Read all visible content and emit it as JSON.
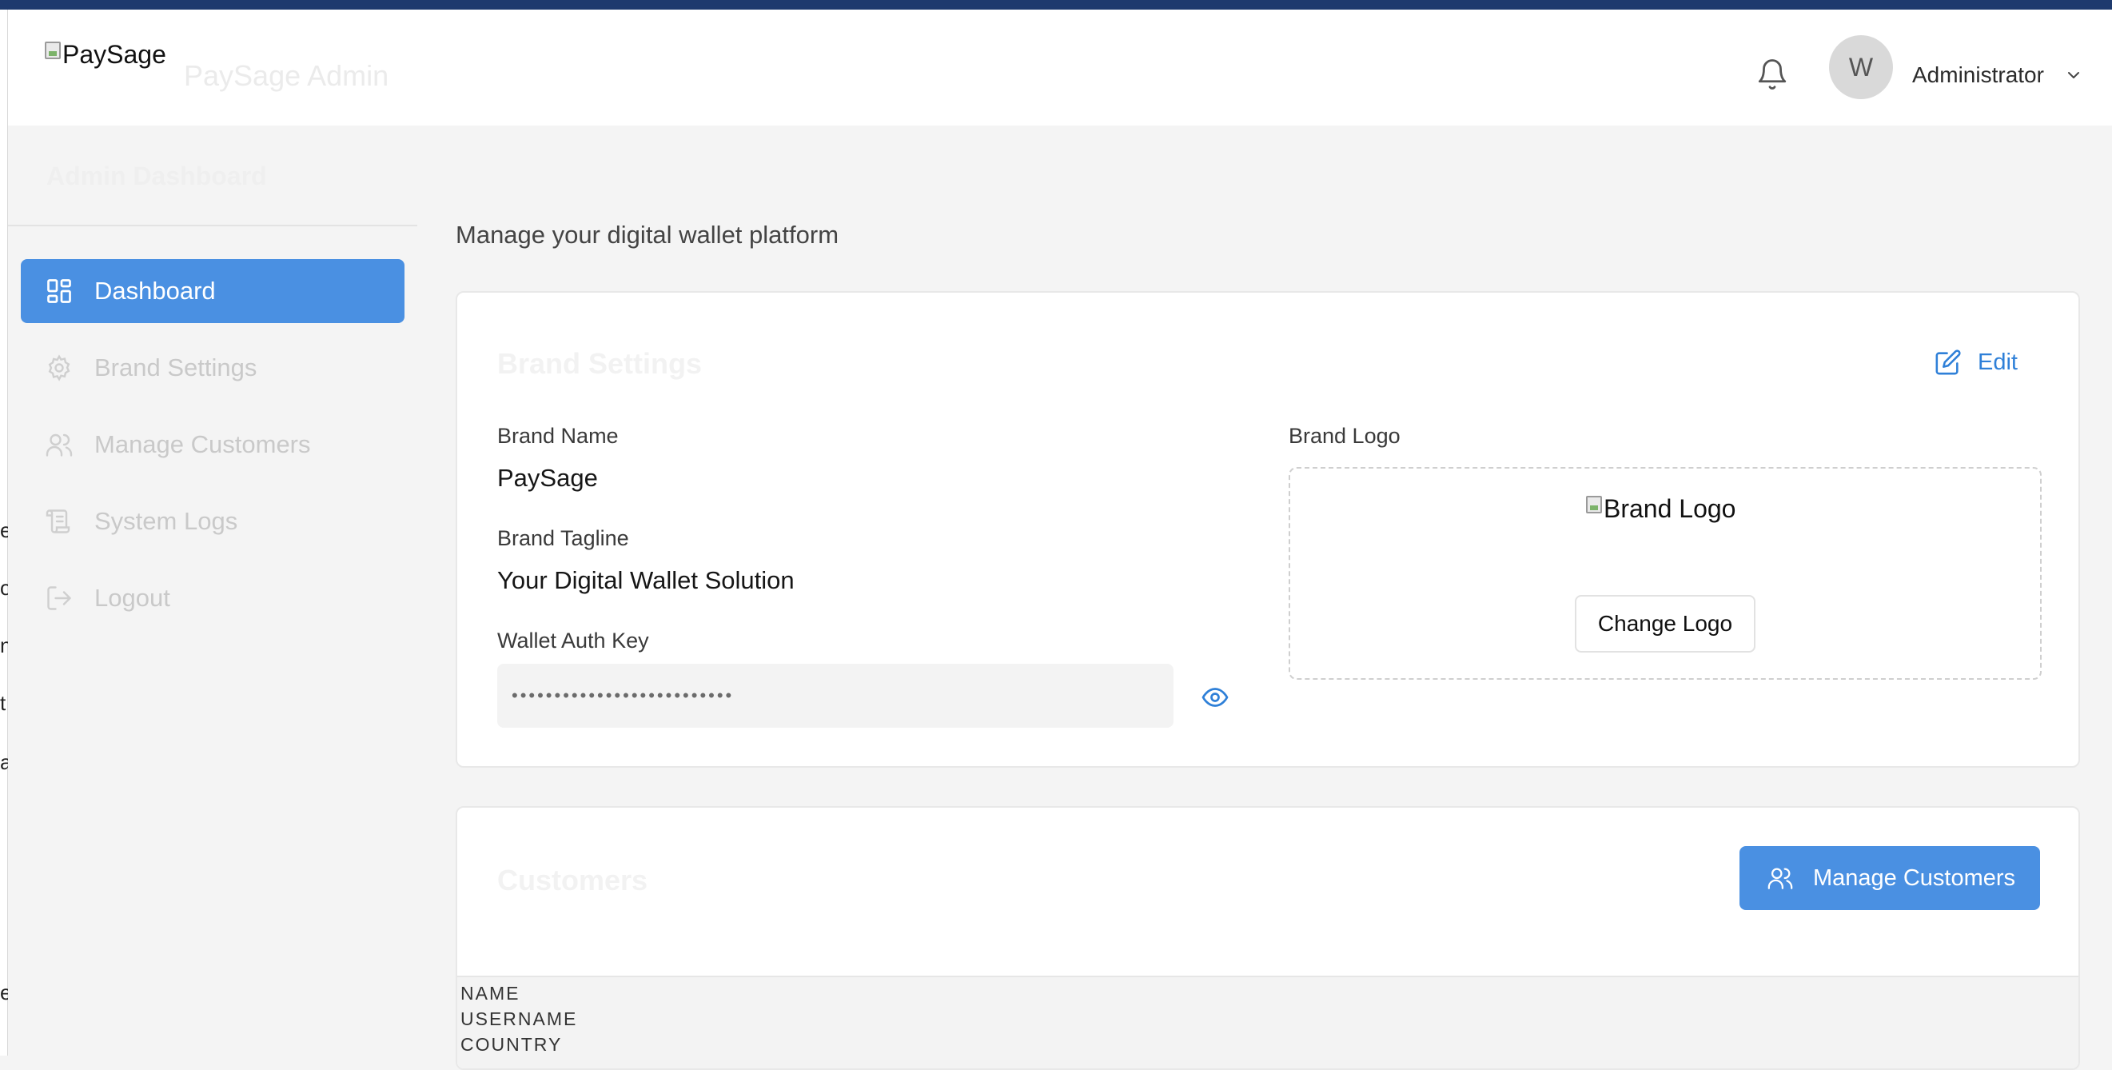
{
  "header": {
    "logo_alt": "PaySage",
    "app_title": "PaySage Admin",
    "avatar_initial": "W",
    "user_name": "Administrator"
  },
  "sidebar": {
    "title": "Admin Dashboard",
    "items": [
      {
        "label": "Dashboard",
        "icon": "dashboard-grid-icon",
        "active": true
      },
      {
        "label": "Brand Settings",
        "icon": "gear-icon",
        "active": false
      },
      {
        "label": "Manage Customers",
        "icon": "users-icon",
        "active": false
      },
      {
        "label": "System Logs",
        "icon": "scroll-icon",
        "active": false
      },
      {
        "label": "Logout",
        "icon": "logout-icon",
        "active": false
      }
    ]
  },
  "edge_chars": [
    "e",
    "o",
    "n",
    "t",
    "a",
    "e"
  ],
  "main": {
    "subtitle": "Manage your digital wallet platform",
    "brand_card": {
      "title": "Brand Settings",
      "edit_label": "Edit",
      "brand_name_label": "Brand Name",
      "brand_name_value": "PaySage",
      "tagline_label": "Brand Tagline",
      "tagline_value": "Your Digital Wallet Solution",
      "auth_key_label": "Wallet Auth Key",
      "auth_key_masked": "••••••••••••••••••••••••••",
      "logo_label": "Brand Logo",
      "logo_alt": "Brand Logo",
      "change_logo_label": "Change Logo"
    },
    "customers_card": {
      "title": "Customers",
      "manage_label": "Manage Customers",
      "columns": [
        "NAME",
        "USERNAME",
        "COUNTRY"
      ]
    }
  },
  "colors": {
    "accent": "#4a90e2",
    "link": "#2f80d8",
    "top_band": "#1e3a6e"
  }
}
